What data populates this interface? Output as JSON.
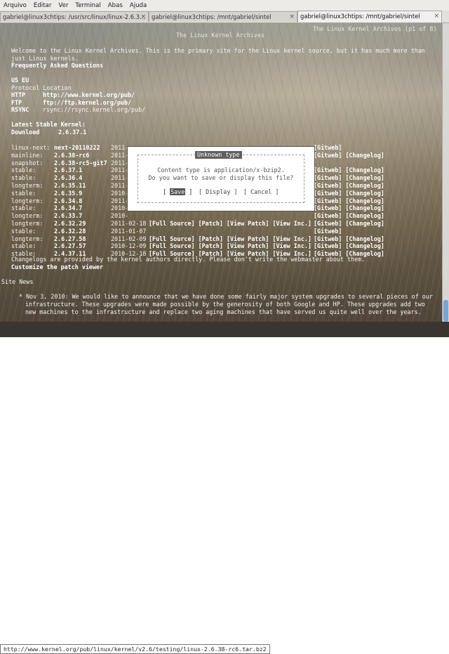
{
  "menubar": {
    "items": [
      "Arquivo",
      "Editar",
      "Ver",
      "Terminal",
      "Abas",
      "Ajuda"
    ]
  },
  "tabs": [
    "gabriel@linux3chtips: /usr/src/linux/linux-2.6.3…",
    "gabriel@linux3chtips: /mnt/gabriel/sintel",
    "gabriel@linux3chtips: /mnt/gabriel/sintel"
  ],
  "page": {
    "header_center": "The Linux Kernel Archives",
    "header_right": "The Linux Kernel Archives (p1 of 8)",
    "welcome_1": "Welcome to the Linux Kernel Archives. This is the primary site for the Linux kernel source, but it has much more than",
    "welcome_2": "just Linux kernels.",
    "faq": "Frequently Asked Questions",
    "region": "US EU",
    "proto_head": "Protocol Location",
    "protocols": [
      {
        "name": "HTTP",
        "location": "http://www.kernel.org/pub/"
      },
      {
        "name": "FTP",
        "location": "ftp://ftp.kernel.org/pub/"
      },
      {
        "name": "RSYNC",
        "location": "rsync://rsync.kernel.org/pub/"
      }
    ],
    "latest_label": "Latest Stable Kernel:",
    "download_label": "Download",
    "download_version": "2.6.37.1",
    "releases": [
      {
        "branch": "linux-next:",
        "version": "next-20110222",
        "date": "2011-",
        "links": "",
        "right": "[Gitweb]"
      },
      {
        "branch": "mainline:",
        "version": "2.6.38-rc6",
        "date": "2011-",
        "links": "",
        "right": "[Gitweb] [Changelog]"
      },
      {
        "branch": "snapshot:",
        "version": "2.6.38-rc5-git7",
        "date": "2011-",
        "links": "",
        "right": ""
      },
      {
        "branch": "stable:",
        "version": "2.6.37.1",
        "date": "2011-",
        "links": "",
        "right": "[Gitweb] [Changelog]"
      },
      {
        "branch": "stable:",
        "version": "2.6.36.4",
        "date": "2011-",
        "links": "",
        "right": "[Gitweb] [Changelog]"
      },
      {
        "branch": "longterm:",
        "version": "2.6.35.11",
        "date": "2011-",
        "links": "",
        "right": "[Gitweb] [Changelog]"
      },
      {
        "branch": "stable:",
        "version": "2.6.35.9",
        "date": "2010-",
        "links": "",
        "right": "[Gitweb] [Changelog]"
      },
      {
        "branch": "longterm:",
        "version": "2.6.34.8",
        "date": "2011-",
        "links": "",
        "right": "[Gitweb] [Changelog]"
      },
      {
        "branch": "stable:",
        "version": "2.6.34.7",
        "date": "2010-",
        "links": "",
        "right": "[Gitweb] [Changelog]"
      },
      {
        "branch": "longterm:",
        "version": "2.6.33.7",
        "date": "2010-",
        "links": "",
        "right": "[Gitweb] [Changelog]"
      },
      {
        "branch": "longterm:",
        "version": "2.6.32.29",
        "date": "2011-02-18",
        "links": "[Full Source] [Patch] [View Patch] [View Inc.]",
        "right": "[Gitweb] [Changelog]"
      },
      {
        "branch": "stable:",
        "version": "2.6.32.28",
        "date": "2011-01-07",
        "links": "",
        "right": "[Gitweb]"
      },
      {
        "branch": "longterm:",
        "version": "2.6.27.58",
        "date": "2011-02-09",
        "links": "[Full Source] [Patch] [View Patch] [View Inc.]",
        "right": "[Gitweb] [Changelog]"
      },
      {
        "branch": "stable:",
        "version": "2.6.27.57",
        "date": "2010-12-09",
        "links": "[Full Source] [Patch] [View Patch] [View Inc.]",
        "right": "[Gitweb] [Changelog]"
      },
      {
        "branch": "stable:",
        "version": "2.4.37.11",
        "date": "2010-12-18",
        "links": "[Full Source] [Patch] [View Patch] [View Inc.]",
        "right": "[Gitweb] [Changelog]"
      }
    ],
    "changelog_note": "Changelogs are provided by the kernel authors directly. Please don't write the webmaster about them.",
    "customize": "Customize the patch viewer",
    "site_news": "Site News",
    "news_1": "* Nov 3, 2010: We would like to announce that we have done some fairly major system upgrades to several pieces of our",
    "news_2": "infrastructure. These upgrades were made possible by the generosity of both Google and HP. These upgrades add two",
    "news_3": "new machines to the infrastructure and replace two aging machines that have served us quite well over the years."
  },
  "dialog": {
    "title": "Unknown type",
    "line1": "Content type is application/x-bzip2.",
    "line2": "Do you want to save or display this file?",
    "save": "Save",
    "display": "[ Display ]",
    "cancel": "[ Cancel ]"
  },
  "status_url": "http://www.kernel.org/pub/linux/kernel/v2.6/testing/linux-2.6.38-rc6.tar.bz2"
}
